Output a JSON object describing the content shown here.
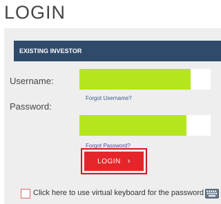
{
  "page": {
    "title": "LOGIN"
  },
  "panel": {
    "header": "EXISTING INVESTOR"
  },
  "form": {
    "username_label": "Username:",
    "username_value": "",
    "forgot_username": "Forgot Username?",
    "password_label": "Password:",
    "password_value": "",
    "forgot_password": "Forgot Password?",
    "login_label": "LOGIN",
    "virtual_keyboard_label": "Click here to use virtual keyboard for the password"
  },
  "icons": {
    "chevron": "chevron-right-icon",
    "keyboard": "keyboard-icon"
  },
  "colors": {
    "header_bg": "#2f4a6b",
    "input_highlight": "#b5e61d",
    "login_bg": "#e4262b",
    "login_outline": "#d0191e",
    "link": "#3a5a8a"
  }
}
